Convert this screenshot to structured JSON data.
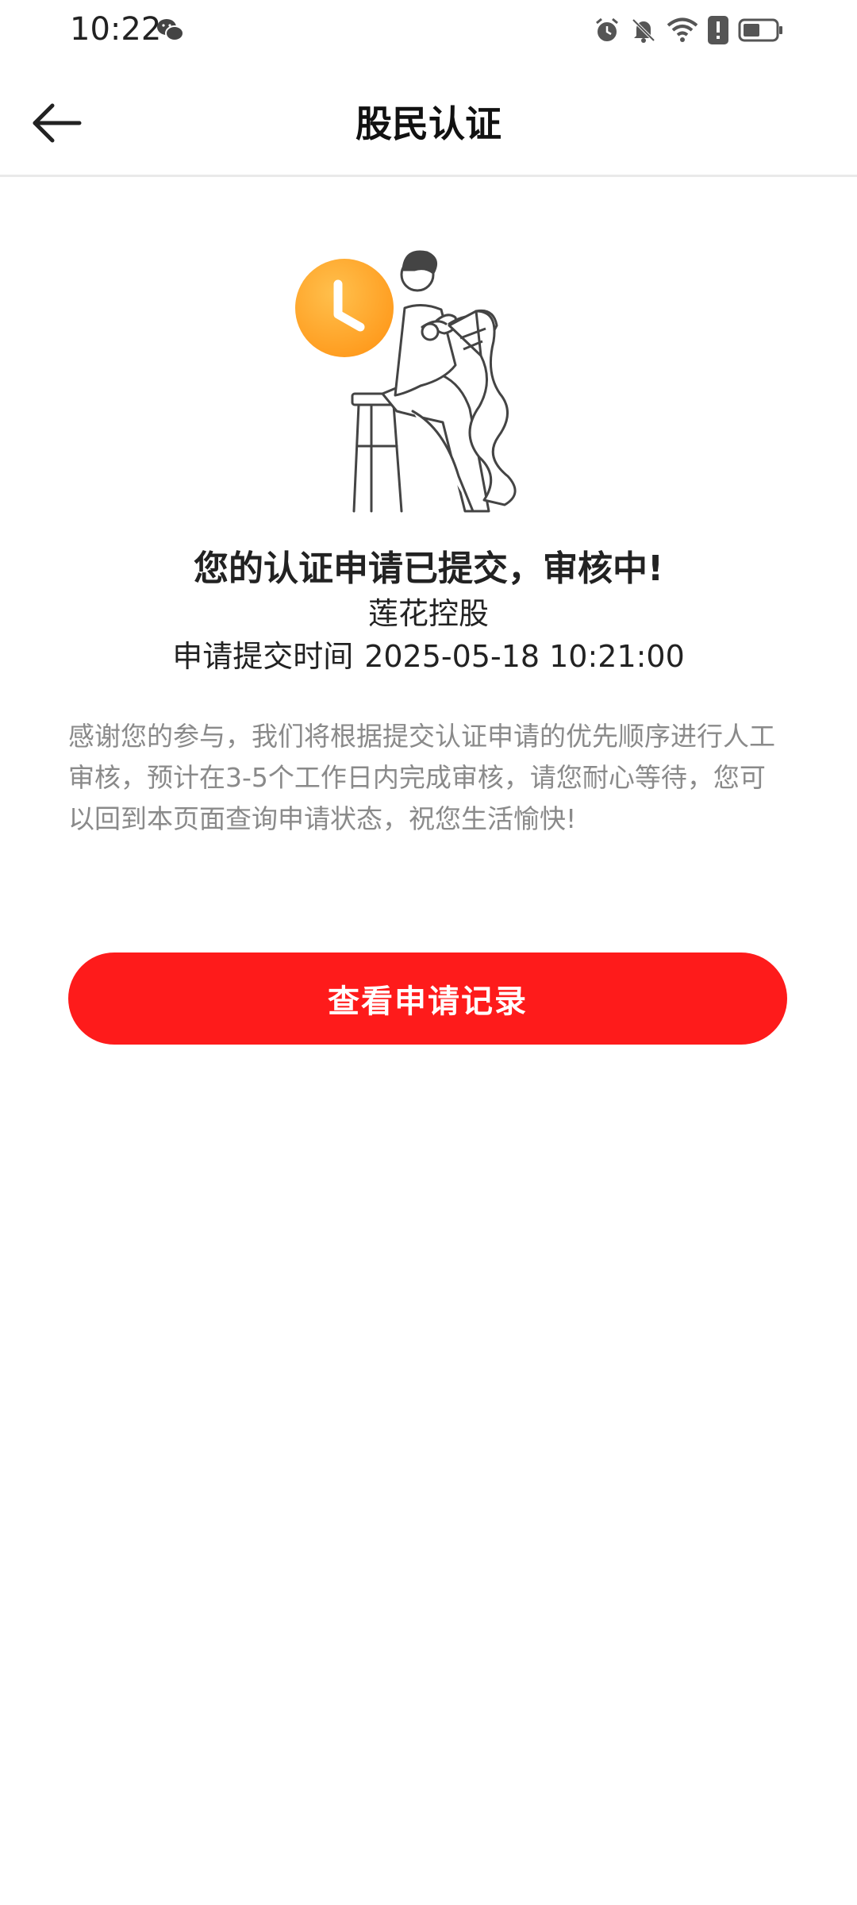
{
  "status_bar": {
    "time": "10:22",
    "icons": [
      "wechat-icon",
      "alarm-icon",
      "bell-off-icon",
      "wifi-icon",
      "notification-icon",
      "battery-icon"
    ]
  },
  "nav": {
    "title": "股民认证",
    "back_icon": "arrow-left-icon"
  },
  "result": {
    "headline": "您的认证申请已提交，审核中!",
    "company": "莲花控股",
    "time_label": "申请提交时间",
    "time_value": "2025-05-18 10:21:00",
    "notice": "感谢您的参与，我们将根据提交认证申请的优先顺序进行人工审核，预计在3-5个工作日内完成审核，请您耐心等待，您可以回到本页面查询申请状态，祝您生活愉快!"
  },
  "actions": {
    "view_records_label": "查看申请记录"
  },
  "colors": {
    "primary": "#fe1b1b",
    "clock_orange": "#ffa126",
    "text_gray": "#8a8a8a"
  }
}
